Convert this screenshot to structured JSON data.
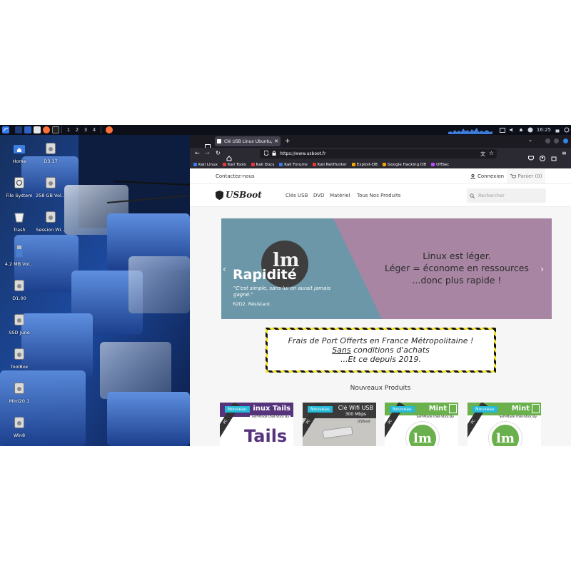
{
  "panel": {
    "workspaces": [
      "1",
      "2",
      "3",
      "4"
    ],
    "clock": "16:25",
    "icons": [
      "kali-menu-icon",
      "terminal-icon",
      "files-icon",
      "editor-icon",
      "firefox-icon",
      "terminal-window-icon"
    ]
  },
  "desktop": {
    "icons": [
      {
        "label": "Home",
        "icon": "home-folder-icon"
      },
      {
        "label": "D3.17",
        "icon": "drive-icon"
      },
      {
        "label": "File System",
        "icon": "filesystem-icon"
      },
      {
        "label": "258 GB Vol...",
        "icon": "drive-icon"
      },
      {
        "label": "Trash",
        "icon": "trash-icon"
      },
      {
        "label": "Session Wi...",
        "icon": "drive-icon"
      },
      {
        "label": "4.2 MB Vol...",
        "icon": "usb-icon"
      },
      {
        "label": "D1.00",
        "icon": "drive-icon"
      },
      {
        "label": "SSD Juno",
        "icon": "drive-icon"
      },
      {
        "label": "ToolBox",
        "icon": "drive-icon"
      },
      {
        "label": "Mint20.1",
        "icon": "drive-icon"
      },
      {
        "label": "Win8",
        "icon": "drive-icon"
      }
    ]
  },
  "browser": {
    "tab_title": "Clé USB Linux Ubuntu, M",
    "new_tab": "+",
    "url": "https://www.usboot.fr",
    "bookmarks": [
      {
        "label": "Kali Linux",
        "color": "#367bf0"
      },
      {
        "label": "Kali Tools",
        "color": "#e53935"
      },
      {
        "label": "Kali Docs",
        "color": "#e53935"
      },
      {
        "label": "Kali Forums",
        "color": "#367bf0"
      },
      {
        "label": "Kali NetHunter",
        "color": "#e53935"
      },
      {
        "label": "Exploit-DB",
        "color": "#f4a300"
      },
      {
        "label": "Google Hacking DB",
        "color": "#f4a300"
      },
      {
        "label": "OffSec",
        "color": "#bb4aff"
      }
    ]
  },
  "site": {
    "contact": "Contactez-nous",
    "login": "Connexion",
    "cart": "Panier (0)",
    "logo": "USBoot",
    "nav": [
      "Clés USB",
      "DVD",
      "Matériel",
      "Tous Nos Produits"
    ],
    "search_placeholder": "Rechercher",
    "slide": {
      "title": "Rapidité",
      "quote": "\"C'est simple, sans lui on aurait jamais gagné.\"",
      "author": "R2D2. Résistant.",
      "right_lines": [
        "Linux est léger.",
        "Léger = économe en ressources",
        "...donc plus rapide !"
      ],
      "left_color": "#6b97a8",
      "right_color": "#a785a3"
    },
    "promo_lines": [
      "Frais de Port Offerts en France Métropolitaine !",
      "Sans",
      " conditions d'achats",
      "...Et ce depuis 2019."
    ],
    "new_products_title": "Nouveaux Produits",
    "products": [
      {
        "badge": "Nouveau",
        "title": "inux Tails",
        "sub": "Self-Made USB-Stick By",
        "extra": "Tails"
      },
      {
        "badge": "Nouveau",
        "title": "Clé Wifi USB",
        "sub": "300 Mbps",
        "extra": "USBoot"
      },
      {
        "badge": "Nouveau",
        "title": "Mint",
        "sub": "Self-Made USB-Stick By",
        "extra": "lm"
      },
      {
        "badge": "Nouveau",
        "title": "Mint",
        "sub": "Self-Made USB-Stick By",
        "extra": "lm"
      }
    ],
    "sash_text": "PC"
  }
}
